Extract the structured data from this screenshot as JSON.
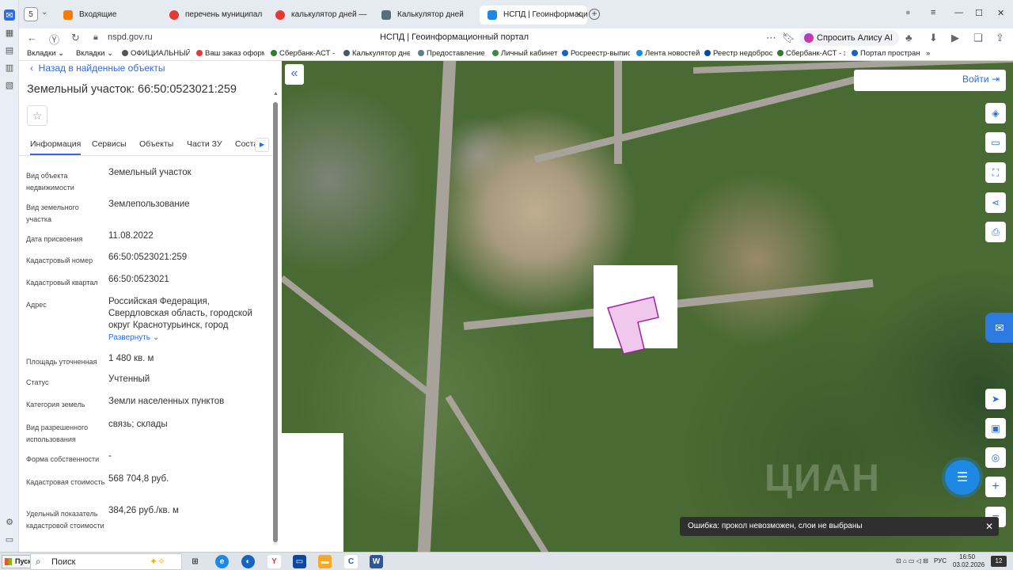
{
  "browser": {
    "tab_counter": "5",
    "tabs": [
      {
        "label": "Входящие"
      },
      {
        "label": "перечень муниципально"
      },
      {
        "label": "калькулятор дней — Янде"
      },
      {
        "label": "Калькулятор дней"
      },
      {
        "label": "НСПД | Геоинформаци"
      }
    ],
    "url": "nspd.gov.ru",
    "page_title": "НСПД | Геоинформационный портал",
    "alice_label": "Спросить Алису AI",
    "bookmarks": [
      {
        "label": "Вкладки",
        "color": "#888888"
      },
      {
        "label": "Вкладки",
        "color": "#888888"
      },
      {
        "label": "ОФИЦИАЛЬНЫЙ",
        "color": "#555555"
      },
      {
        "label": "Ваш заказ оформ",
        "color": "#e53935"
      },
      {
        "label": "Сбербанк-АСТ - з",
        "color": "#2e7d32"
      },
      {
        "label": "Калькулятор дне",
        "color": "#455a64"
      },
      {
        "label": "Предоставление",
        "color": "#607d8b"
      },
      {
        "label": "Личный кабинет",
        "color": "#388e3c"
      },
      {
        "label": "Росреестр-выпис",
        "color": "#1565c0"
      },
      {
        "label": "Лента новостей",
        "color": "#1e88e5"
      },
      {
        "label": "Реестр недобросо",
        "color": "#0d47a1"
      },
      {
        "label": "Сбербанк-АСТ - з",
        "color": "#2e7d32"
      },
      {
        "label": "Портал простран",
        "color": "#1565c0"
      }
    ]
  },
  "panel": {
    "back_label": "Назад в найденные объекты",
    "title": "Земельный участок: 66:50:0523021:259",
    "tabs": [
      {
        "label": "Информация"
      },
      {
        "label": "Сервисы"
      },
      {
        "label": "Объекты"
      },
      {
        "label": "Части ЗУ"
      },
      {
        "label": "Соста"
      }
    ],
    "fields": [
      {
        "label": "Вид объекта недвижимости",
        "value": "Земельный участок"
      },
      {
        "label": "Вид земельного участка",
        "value": "Землепользование"
      },
      {
        "label": "Дата присвоения",
        "value": "11.08.2022"
      },
      {
        "label": "Кадастровый номер",
        "value": "66:50:0523021:259"
      },
      {
        "label": "Кадастровый квартал",
        "value": "66:50:0523021"
      },
      {
        "label": "Адрес",
        "value": "Российская Федерация, Свердловская область, городской округ Краснотурьинск, город"
      },
      {
        "label": "Площадь уточненная",
        "value": "1 480 кв. м"
      },
      {
        "label": "Статус",
        "value": "Учтенный"
      },
      {
        "label": "Категория земель",
        "value": "Земли населенных пунктов"
      },
      {
        "label": "Вид разрешенного использования",
        "value": "связь; склады"
      },
      {
        "label": "Форма собственности",
        "value": "-"
      },
      {
        "label": "Кадастровая стоимость",
        "value": "568 704,8 руб."
      },
      {
        "label": "Удельный показатель кадастровой стоимости",
        "value": "384,26 руб./кв. м"
      }
    ],
    "expand_label": "Развернуть"
  },
  "map": {
    "login_label": "Войти",
    "toast": "Ошибка: прокол невозможен, слои не выбраны",
    "watermark": "ЦИАН",
    "parcel_fill": "#f0c8ee",
    "parcel_stroke": "#a020a0"
  },
  "taskbar": {
    "start_label": "Пуск",
    "search_label": "Поиск",
    "lang": "РУС",
    "time": "16:50",
    "date": "03.02.2026",
    "notif_count": "12"
  }
}
